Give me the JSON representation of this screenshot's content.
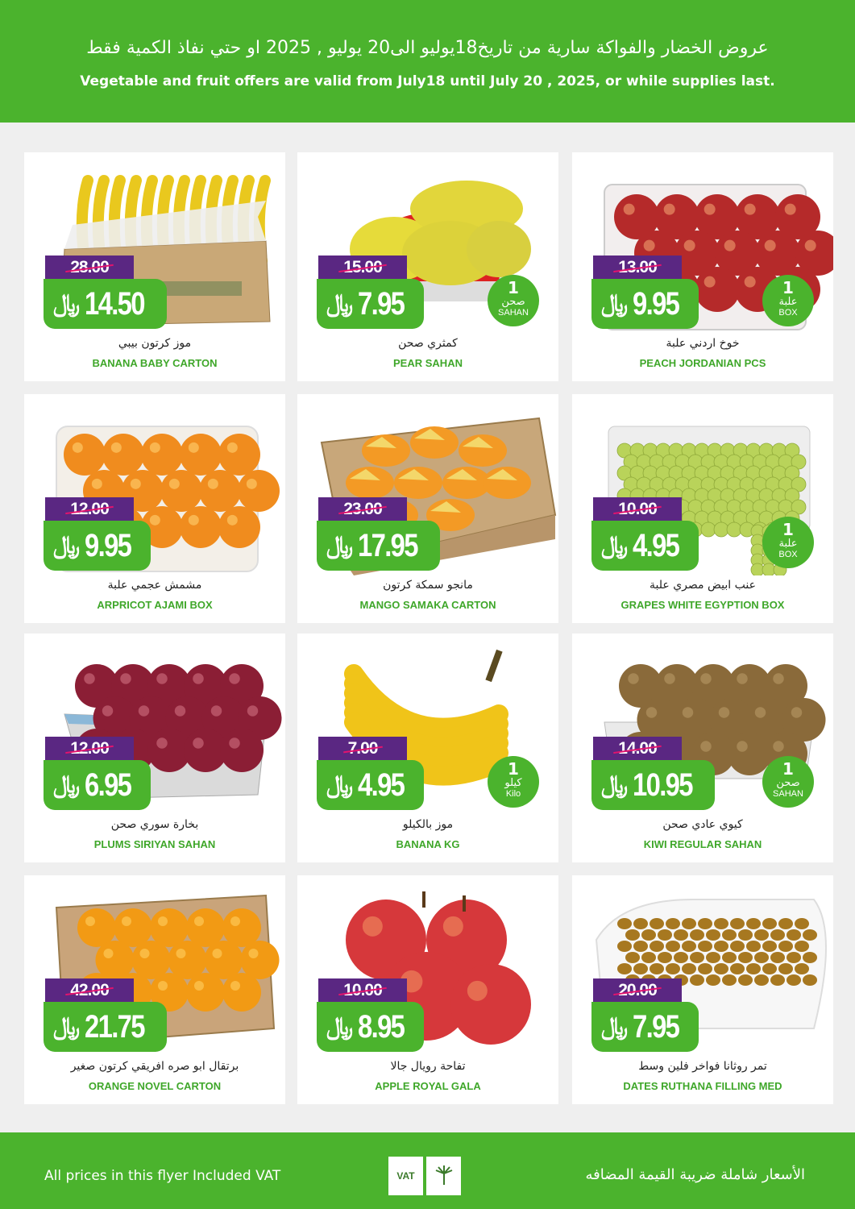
{
  "header": {
    "arabic": "عروض الخضار والفواكة سارية من تاريخ18يوليو الى20 يوليو , 2025 او حتي نفاذ الكمية فقط",
    "english": "Vegetable and fruit offers are valid from July18 until July 20 , 2025, or while supplies last."
  },
  "currency_symbol": "﷼",
  "products": [
    {
      "name_ar": "موز كرتون بيبي",
      "name_en": "BANANA BABY CARTON",
      "old_price": "28.00",
      "new_price": "14.50",
      "unit_count": "",
      "unit_ar": "",
      "unit_en": "",
      "image": "banana-carton"
    },
    {
      "name_ar": "كمثري صحن",
      "name_en": "PEAR SAHAN",
      "old_price": "15.00",
      "new_price": "7.95",
      "unit_count": "1",
      "unit_ar": "صحن",
      "unit_en": "SAHAN",
      "image": "pears"
    },
    {
      "name_ar": "خوخ اردني علبة",
      "name_en": "PEACH JORDANIAN PCS",
      "old_price": "13.00",
      "new_price": "9.95",
      "unit_count": "1",
      "unit_ar": "علبة",
      "unit_en": "BOX",
      "image": "peaches-box"
    },
    {
      "name_ar": "مشمش عجمي علبة",
      "name_en": "ARPRICOT AJAMI BOX",
      "old_price": "12.00",
      "new_price": "9.95",
      "unit_count": "",
      "unit_ar": "",
      "unit_en": "",
      "image": "apricots-box"
    },
    {
      "name_ar": "مانجو سمكة كرتون",
      "name_en": "MANGO SAMAKA CARTON",
      "old_price": "23.00",
      "new_price": "17.95",
      "unit_count": "",
      "unit_ar": "",
      "unit_en": "",
      "image": "mango-carton"
    },
    {
      "name_ar": "عنب ابيض مصري علبة",
      "name_en": "GRAPES WHITE EGYPTION BOX",
      "old_price": "10.00",
      "new_price": "4.95",
      "unit_count": "1",
      "unit_ar": "علبة",
      "unit_en": "BOX",
      "image": "grapes-box"
    },
    {
      "name_ar": "بخارة سوري صحن",
      "name_en": "PLUMS  SIRIYAN SAHAN",
      "old_price": "12.00",
      "new_price": "6.95",
      "unit_count": "",
      "unit_ar": "",
      "unit_en": "",
      "image": "plums-tray"
    },
    {
      "name_ar": "موز  بالكيلو",
      "name_en": "BANANA KG",
      "old_price": "7.00",
      "new_price": "4.95",
      "unit_count": "1",
      "unit_ar": "كيلو",
      "unit_en": "Kilo",
      "image": "banana-bunch"
    },
    {
      "name_ar": "كيوي عادي صحن",
      "name_en": "KIWI REGULAR SAHAN",
      "old_price": "14.00",
      "new_price": "10.95",
      "unit_count": "1",
      "unit_ar": "صحن",
      "unit_en": "SAHAN",
      "image": "kiwi-tray"
    },
    {
      "name_ar": "برتقال ابو صره افريقي كرتون صغير",
      "name_en": "ORANGE  NOVEL CARTON",
      "old_price": "42.00",
      "new_price": "21.75",
      "unit_count": "",
      "unit_ar": "",
      "unit_en": "",
      "image": "oranges-carton"
    },
    {
      "name_ar": "تفاحة رويال جالا",
      "name_en": "APPLE ROYAL GALA",
      "old_price": "10.00",
      "new_price": "8.95",
      "unit_count": "",
      "unit_ar": "",
      "unit_en": "",
      "image": "apples"
    },
    {
      "name_ar": "تمر روثانا فواخر فلين وسط",
      "name_en": "DATES RUTHANA FILLING MED",
      "old_price": "20.00",
      "new_price": "7.95",
      "unit_count": "",
      "unit_ar": "",
      "unit_en": "",
      "image": "dates-foam"
    }
  ],
  "footer": {
    "english": "All prices in this flyer Included VAT",
    "arabic": "الأسعار شاملة ضريبة القيمة المضافه",
    "vat_logo_text": "VAT"
  },
  "colors": {
    "brand_green": "#4bb32d",
    "old_price_purple": "#5a2782",
    "strike_pink": "#e2136e"
  }
}
